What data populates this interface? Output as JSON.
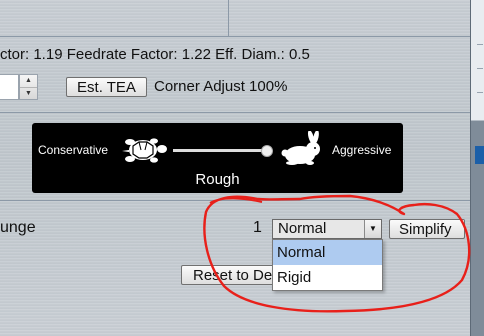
{
  "factors_line": "ctor: 1.19 Feedrate Factor: 1.22 Eff. Diam.: 0.5",
  "est_tea_button": "Est. TEA",
  "corner_adjust": "Corner Adjust 100%",
  "slider": {
    "left_label": "Conservative",
    "right_label": "Aggressive",
    "value_label": "Rough",
    "position": 0.98
  },
  "plunge": {
    "label": "unge",
    "value": "1",
    "selected": "Normal",
    "options": [
      "Normal",
      "Rigid"
    ]
  },
  "simplify_button": "Simplify",
  "reset_button": "Reset to Defaults",
  "colors": {
    "annotation": "#e8201a",
    "highlight": "#aecbf0",
    "slider_bg": "#000000"
  }
}
